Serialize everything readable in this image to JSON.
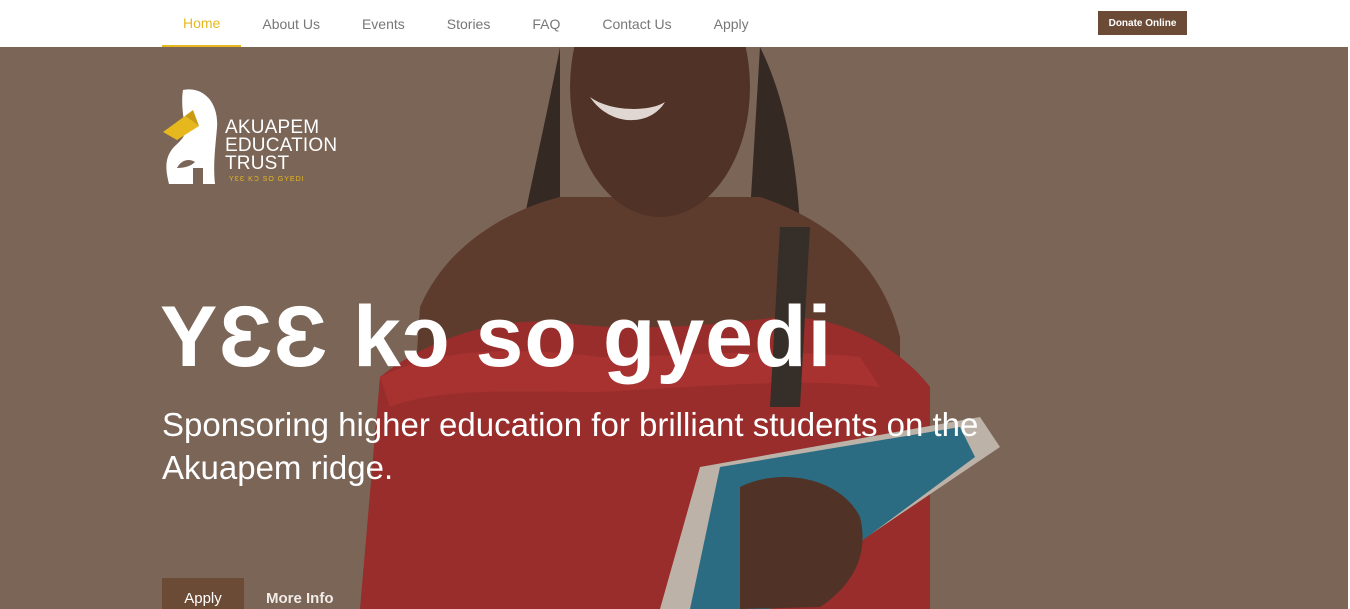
{
  "nav": {
    "items": [
      {
        "label": "Home",
        "active": true
      },
      {
        "label": "About Us",
        "active": false
      },
      {
        "label": "Events",
        "active": false
      },
      {
        "label": "Stories",
        "active": false
      },
      {
        "label": "FAQ",
        "active": false
      },
      {
        "label": "Contact Us",
        "active": false
      },
      {
        "label": "Apply",
        "active": false
      }
    ],
    "donate_label": "Donate Online"
  },
  "logo": {
    "line1": "AKUAPEM",
    "line2": "EDUCATION",
    "line3": "TRUST",
    "tagline": "YƐƐ KƆ SO GYEDI",
    "icon": "elephant-graduation-cap-icon"
  },
  "hero": {
    "headline": "YƐƐ kɔ so gyedi",
    "subhead": "Sponsoring higher education for brilliant students on the Akuapem ridge.",
    "apply_label": "Apply",
    "more_label": "More Info"
  },
  "colors": {
    "accent": "#e6b81e",
    "brand_brown": "#6b4a36",
    "overlay": "#7b6557"
  }
}
